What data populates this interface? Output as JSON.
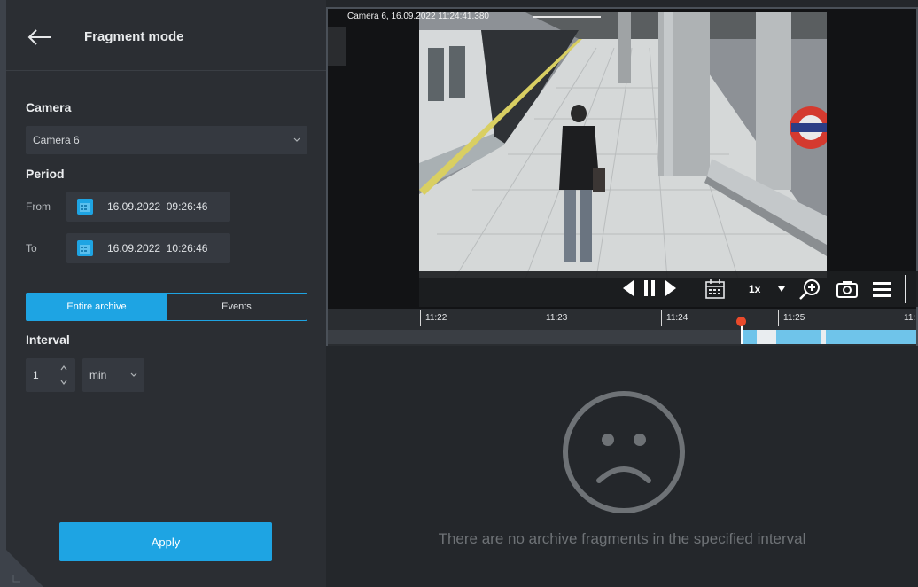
{
  "colors": {
    "accent": "#1ea4e3",
    "panel_bg": "#2b2e33",
    "field_bg": "#353940",
    "archive_bar": "#6fc4ea",
    "playhead": "#ea4a2b"
  },
  "header": {
    "title": "Fragment mode",
    "back_icon": "arrow-left-icon"
  },
  "camera": {
    "label": "Camera",
    "selected": "Camera 6"
  },
  "period": {
    "label": "Period",
    "from_label": "From",
    "from_value": "16.09.2022  09:26:46",
    "to_label": "To",
    "to_value": "16.09.2022  10:26:46"
  },
  "mode_tabs": [
    {
      "label": "Entire archive",
      "active": true
    },
    {
      "label": "Events",
      "active": false
    }
  ],
  "interval": {
    "label": "Interval",
    "value": "1",
    "unit": "min"
  },
  "apply_label": "Apply",
  "video": {
    "overlay_text": "Camera 6, 16.09.2022 11:24:41.380",
    "speed": "1x",
    "controls": [
      "prev-frame-icon",
      "pause-icon",
      "next-frame-icon",
      "calendar-icon",
      "speed-dropdown-icon",
      "zoom-in-icon",
      "snapshot-icon",
      "menu-icon"
    ]
  },
  "timeline": {
    "ticks": [
      "11:22",
      "11:23",
      "11:24",
      "11:25",
      "11:"
    ]
  },
  "empty_state": {
    "icon": "sad-face-icon",
    "message": "There are no archive fragments in the specified interval"
  }
}
